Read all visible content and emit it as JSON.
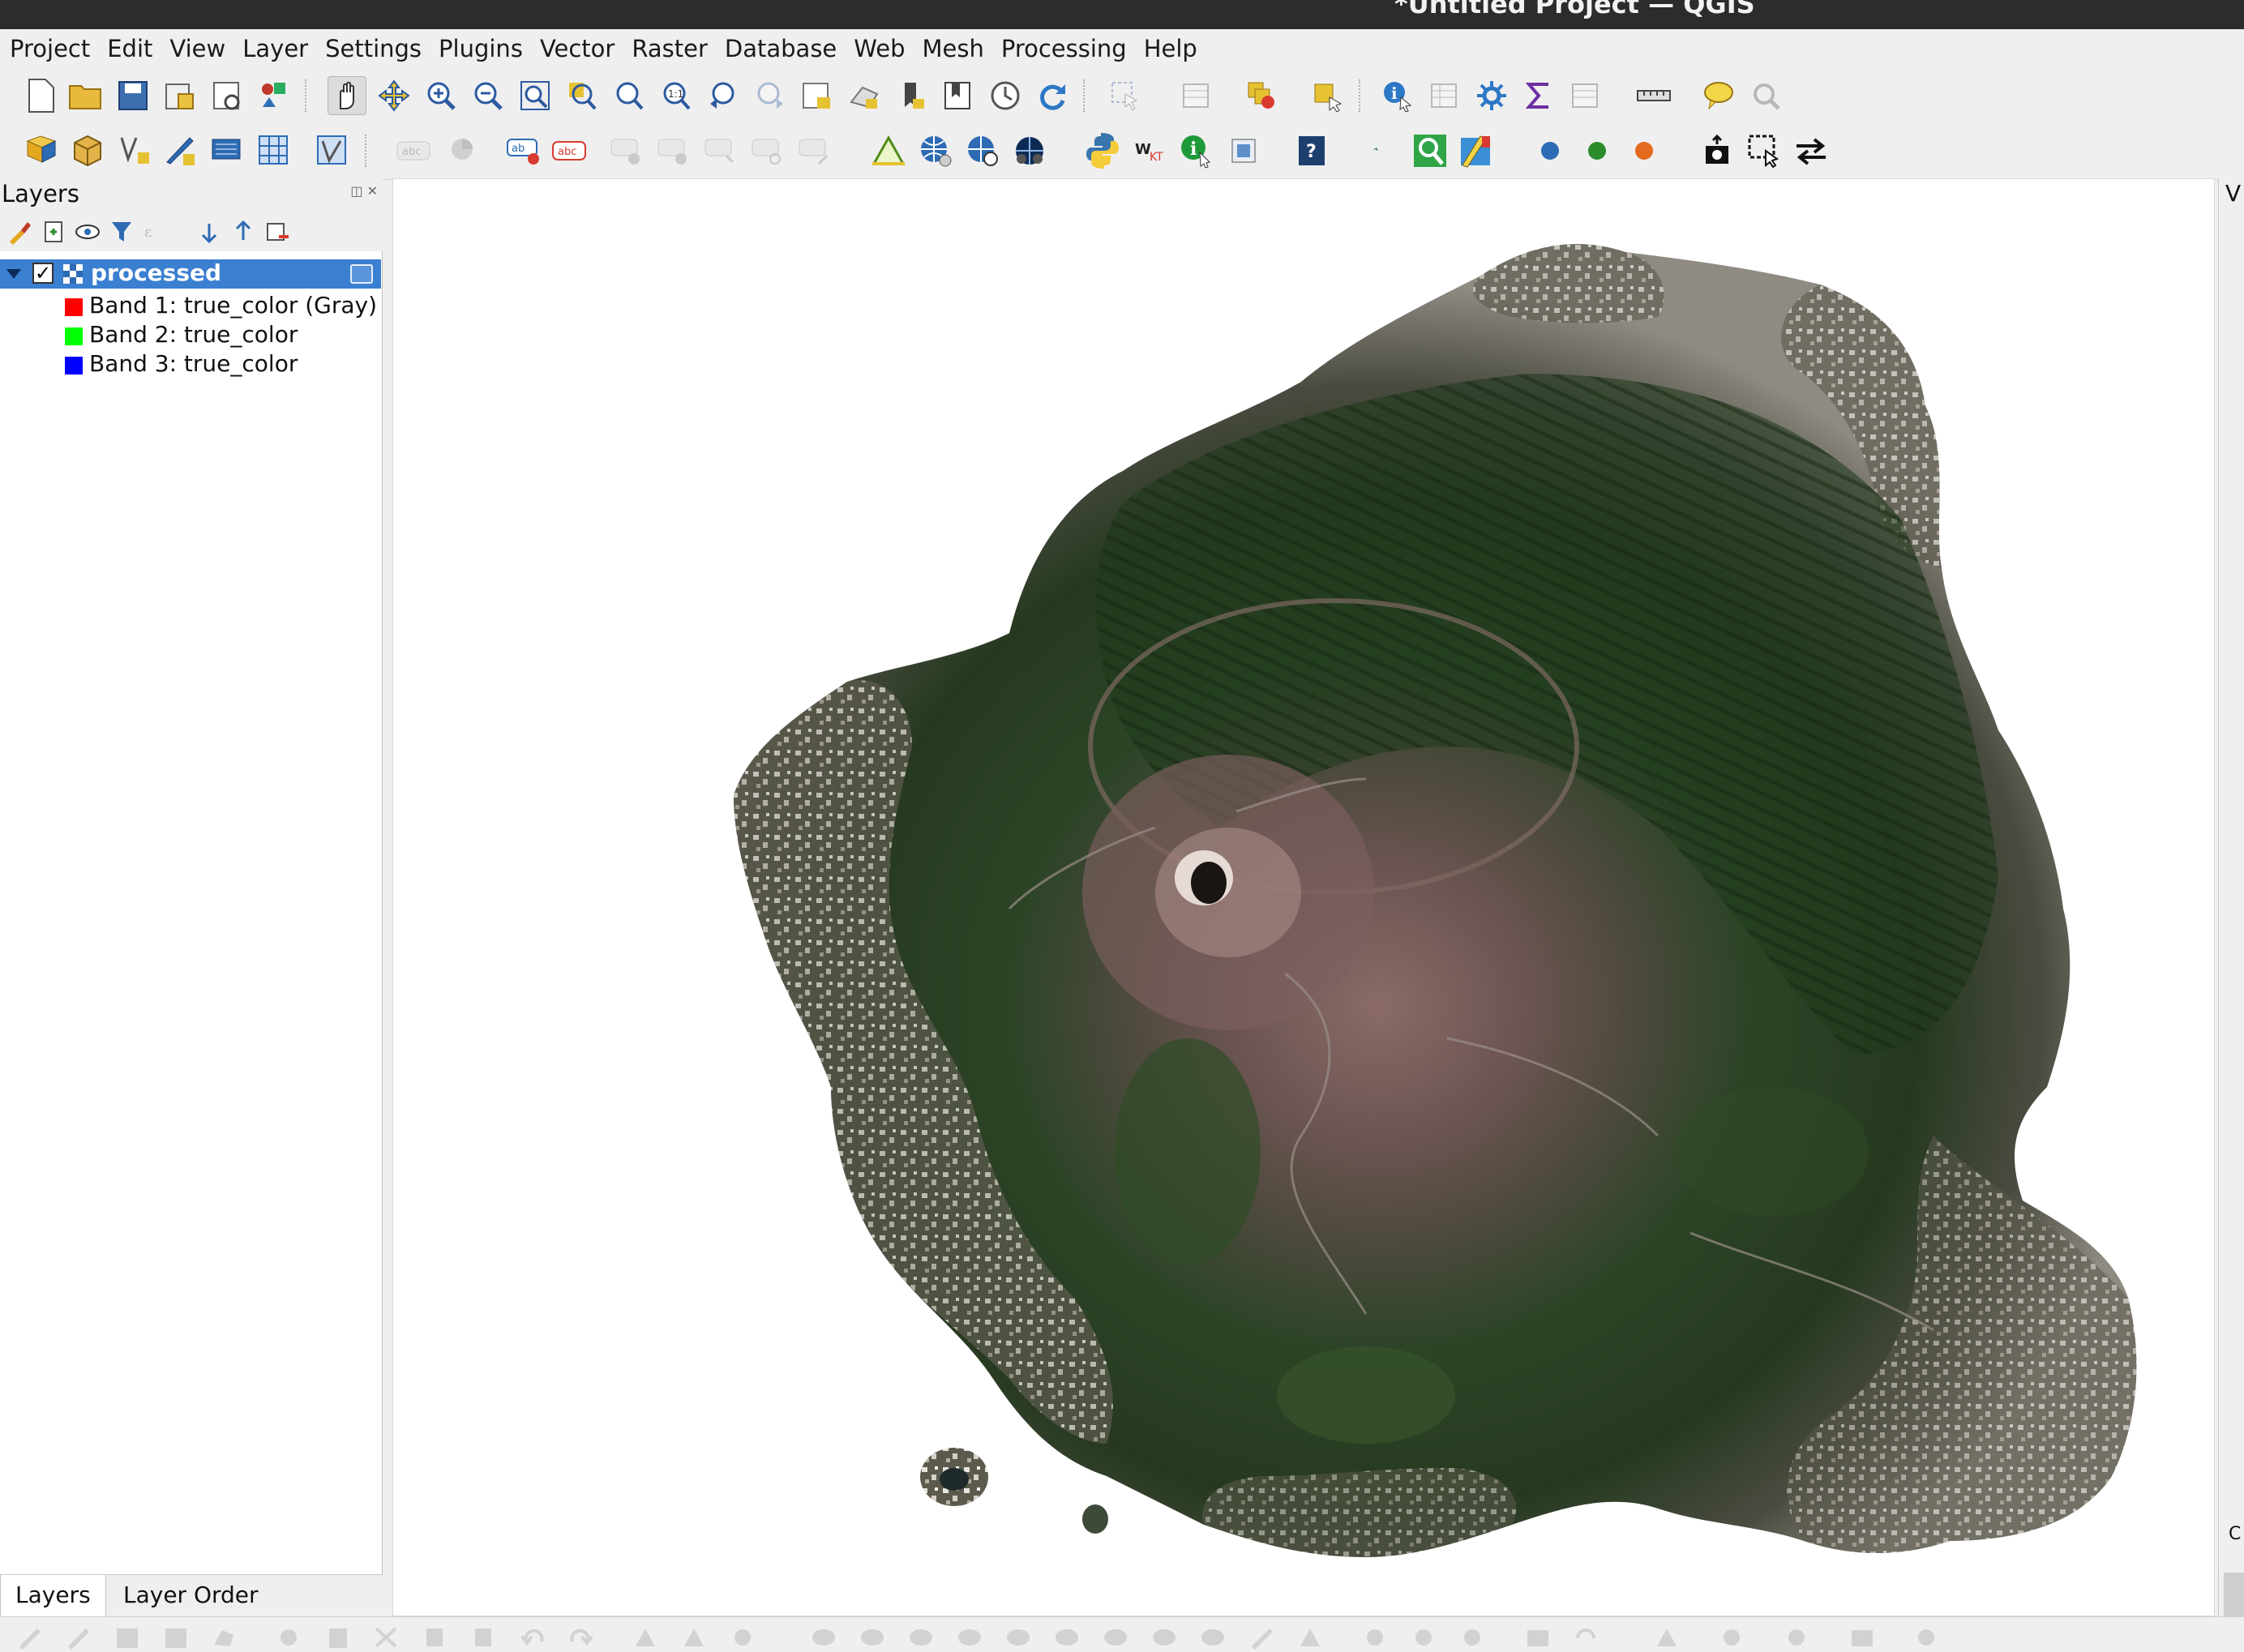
{
  "window": {
    "title": "*Untitled Project — QGIS"
  },
  "menubar": {
    "items": [
      "Project",
      "Edit",
      "View",
      "Layer",
      "Settings",
      "Plugins",
      "Vector",
      "Raster",
      "Database",
      "Web",
      "Mesh",
      "Processing",
      "Help"
    ]
  },
  "toolbar1": {
    "icons": [
      "new-project-icon",
      "open-project-icon",
      "save-project-icon",
      "save-as-icon",
      "print-layout-icon",
      "style-manager-icon",
      "pan-icon",
      "pan-to-selection-icon",
      "zoom-in-icon",
      "zoom-out-icon",
      "zoom-full-icon",
      "zoom-to-selection-icon",
      "zoom-to-layer-icon",
      "zoom-native-icon",
      "zoom-last-icon",
      "zoom-next-icon",
      "new-map-view-icon",
      "new-3d-view-icon",
      "new-bookmark-icon",
      "show-bookmarks-icon",
      "temporal-controller-icon",
      "refresh-icon",
      "select-features-icon",
      "select-by-value-icon",
      "deselect-icon",
      "select-location-icon",
      "identify-icon",
      "attribute-table-icon",
      "settings-icon",
      "statistics-sigma-icon",
      "field-calculator-icon",
      "measure-icon",
      "map-tips-icon",
      "locator-icon"
    ]
  },
  "toolbar2": {
    "icons": [
      "data-source-manager-icon",
      "new-geopackage-icon",
      "new-shapefile-icon",
      "digitize-icon",
      "new-temp-layer-icon",
      "new-virtual-layer-icon",
      "new-mesh-icon",
      "label-toolbar-icon",
      "diagram-icon",
      "layer-labeling-icon",
      "label-abc-icon",
      "pin-label-icon",
      "show-label-icon",
      "move-label-icon",
      "rotate-label-icon",
      "change-label-icon",
      "triangle-icon",
      "globe-icon",
      "globe-search-icon",
      "globe-dark-icon",
      "python-icon",
      "wkt-icon",
      "info-icon",
      "plugin-image-icon",
      "help-icon",
      "small-star-icon",
      "magnifier-green-icon",
      "paint-icon",
      "wkt-dot-icon",
      "ewkt-dot-icon",
      "json-dot-icon",
      "screenshot-icon",
      "capture-icon",
      "swap-arrows-icon"
    ]
  },
  "layers_panel": {
    "title": "Layers",
    "layer": {
      "name": "processed",
      "checked": "✓"
    },
    "bands": [
      {
        "label": "Band 1: true_color (Gray)",
        "color": "#ff0000"
      },
      {
        "label": "Band 2: true_color",
        "color": "#00ff00"
      },
      {
        "label": "Band 3: true_color",
        "color": "#0000ff"
      }
    ],
    "tabs": [
      "Layers",
      "Layer Order"
    ]
  },
  "right_dock": {
    "label": "V",
    "label2": "C"
  },
  "colors": {
    "selection": "#3a7fd0",
    "vegetation_dark": "#1f3a1c",
    "vegetation": "#3e5a34",
    "crater_brown": "#6b5250",
    "urban_light": "#c9c2bd"
  }
}
